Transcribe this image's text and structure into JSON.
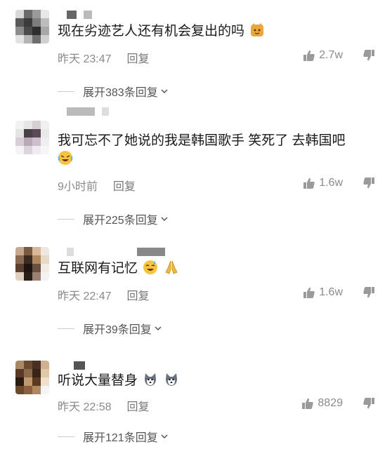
{
  "comments": [
    {
      "text": "现在劣迹艺人还有机会复出的吗",
      "time": "昨天 23:47",
      "reply": "回复",
      "likes": "2.7w",
      "expand": "展开383条回复"
    },
    {
      "text": "我可忘不了她说的我是韩国歌手 笑死了 去韩国吧",
      "time": "9小时前",
      "reply": "回复",
      "likes": "1.6w",
      "expand": "展开225条回复"
    },
    {
      "text": "互联网有记忆",
      "time": "昨天 22:47",
      "reply": "回复",
      "likes": "1.6w",
      "expand": "展开39条回复"
    },
    {
      "text": "听说大量替身",
      "time": "昨天 22:58",
      "reply": "回复",
      "likes": "8829",
      "expand": "展开121条回复"
    }
  ],
  "icons": {
    "like": "thumbs-up-icon",
    "dislike": "thumbs-down-icon",
    "expand": "chevron-down-icon"
  },
  "colors": {
    "text": "#1a1a1a",
    "meta": "#8a8a8a",
    "expand": "#555555"
  }
}
